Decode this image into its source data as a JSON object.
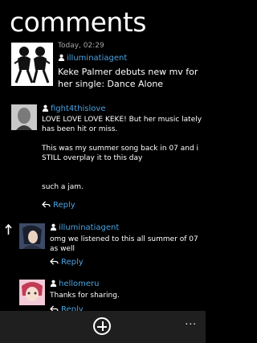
{
  "page": {
    "title": "comments"
  },
  "post": {
    "timestamp": "Today, 02:29",
    "author": "illuminatiagent",
    "headline": "Keke Palmer debuts new mv  for her single: Dance Alone"
  },
  "comments": [
    {
      "author": "fight4thislove",
      "lines": [
        "LOVE LOVE LOVE KEKE! But her music lately",
        "has been hit or miss.",
        "",
        "This was my summer song back in 07 and i",
        "STILL overplay it to this day",
        "",
        "",
        "such a jam."
      ],
      "reply_label": "Reply"
    },
    {
      "author": "illuminatiagent",
      "lines": [
        "omg we listened to this all summer of 07",
        "as well"
      ],
      "reply_label": "Reply"
    },
    {
      "author": "hellomeru",
      "lines": [
        "Thanks for sharing."
      ],
      "reply_label": "Reply"
    }
  ],
  "appbar": {
    "more_label": "..."
  },
  "icons": {
    "user": "user-icon",
    "reply": "reply-icon",
    "add": "add-icon",
    "up": "arrow-up-icon"
  },
  "colors": {
    "accent": "#4aa3e0",
    "background": "#000000",
    "appbar": "#1f1f1f"
  }
}
